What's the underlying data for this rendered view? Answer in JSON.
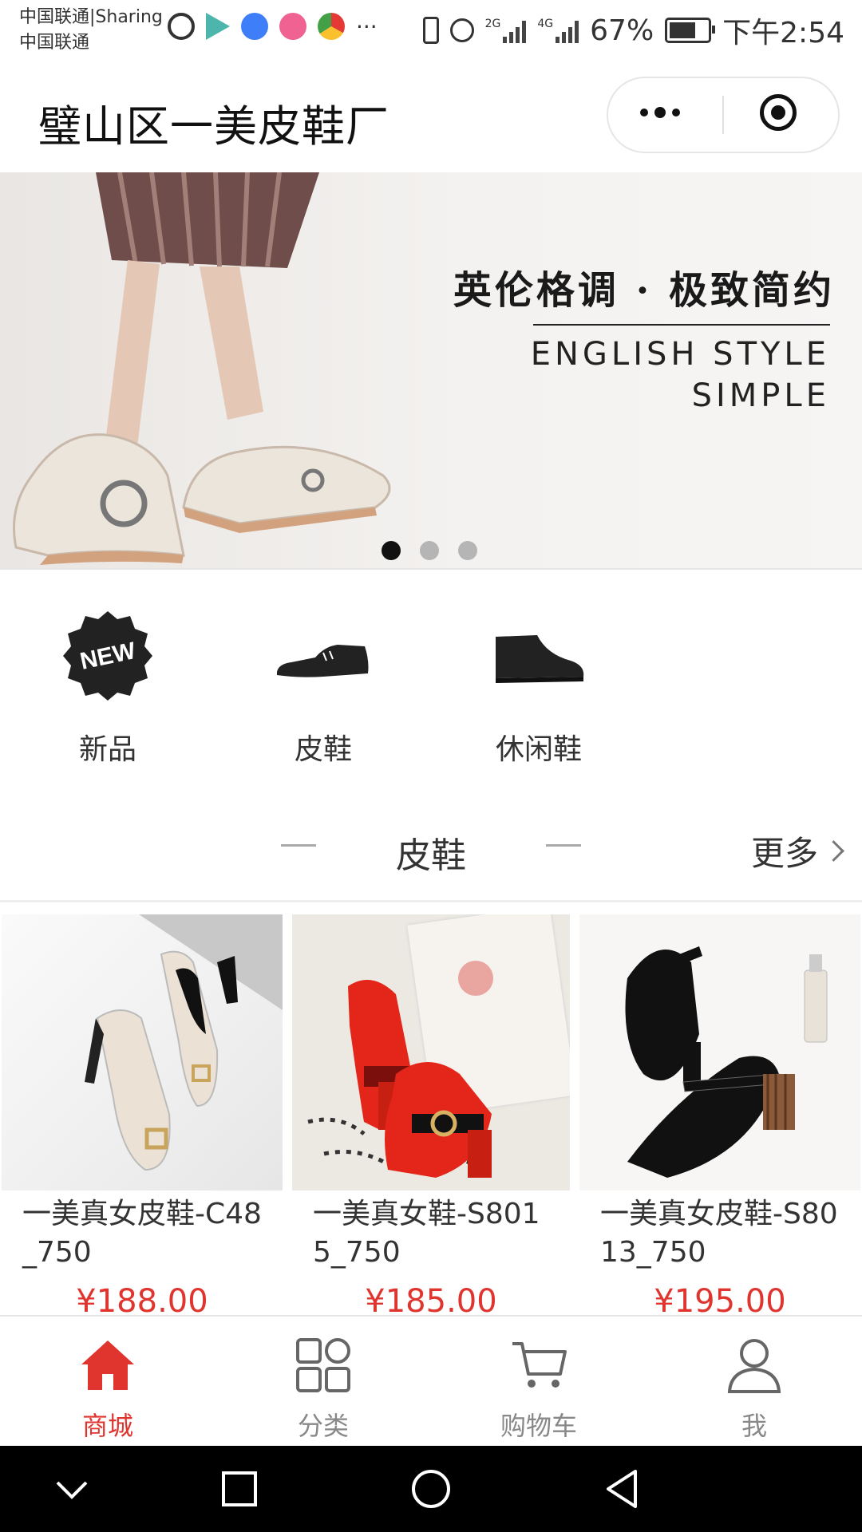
{
  "status_bar": {
    "carrier_line1": "中国联通|Sharing",
    "carrier_line2": "中国联通",
    "network_2g": "2G",
    "network_4g": "4G",
    "battery": "67%",
    "time": "下午2:54",
    "battery_level": 0.67
  },
  "header": {
    "title": "璧山区一美皮鞋厂"
  },
  "banner": {
    "headline": "英伦格调 · 极致简约",
    "sub_line1": "ENGLISH STYLE",
    "sub_line2": "SIMPLE",
    "slide_count": 3,
    "active_slide": 1
  },
  "categories": [
    {
      "label": "新品",
      "icon": "new-badge-icon",
      "badge_text": "NEW"
    },
    {
      "label": "皮鞋",
      "icon": "leather-shoe-icon"
    },
    {
      "label": "休闲鞋",
      "icon": "casual-shoe-icon"
    }
  ],
  "section": {
    "title": "皮鞋",
    "more_label": "更多"
  },
  "products": [
    {
      "name": "一美真女皮鞋-C48_750",
      "price": "¥188.00",
      "photo_note": "cream pumps with buckle"
    },
    {
      "name": "一美真女鞋-S8015_750",
      "price": "¥185.00",
      "photo_note": "red suede heels"
    },
    {
      "name": "一美真女皮鞋-S8013_750",
      "price": "¥195.00",
      "photo_note": "black mary jane shoes"
    }
  ],
  "tabbar": [
    {
      "label": "商城",
      "icon": "home-icon",
      "active": true
    },
    {
      "label": "分类",
      "icon": "category-grid-icon",
      "active": false
    },
    {
      "label": "购物车",
      "icon": "cart-icon",
      "active": false
    },
    {
      "label": "我",
      "icon": "user-icon",
      "active": false
    }
  ],
  "colors": {
    "accent": "#e0342f",
    "text": "#333333",
    "muted": "#888888"
  }
}
